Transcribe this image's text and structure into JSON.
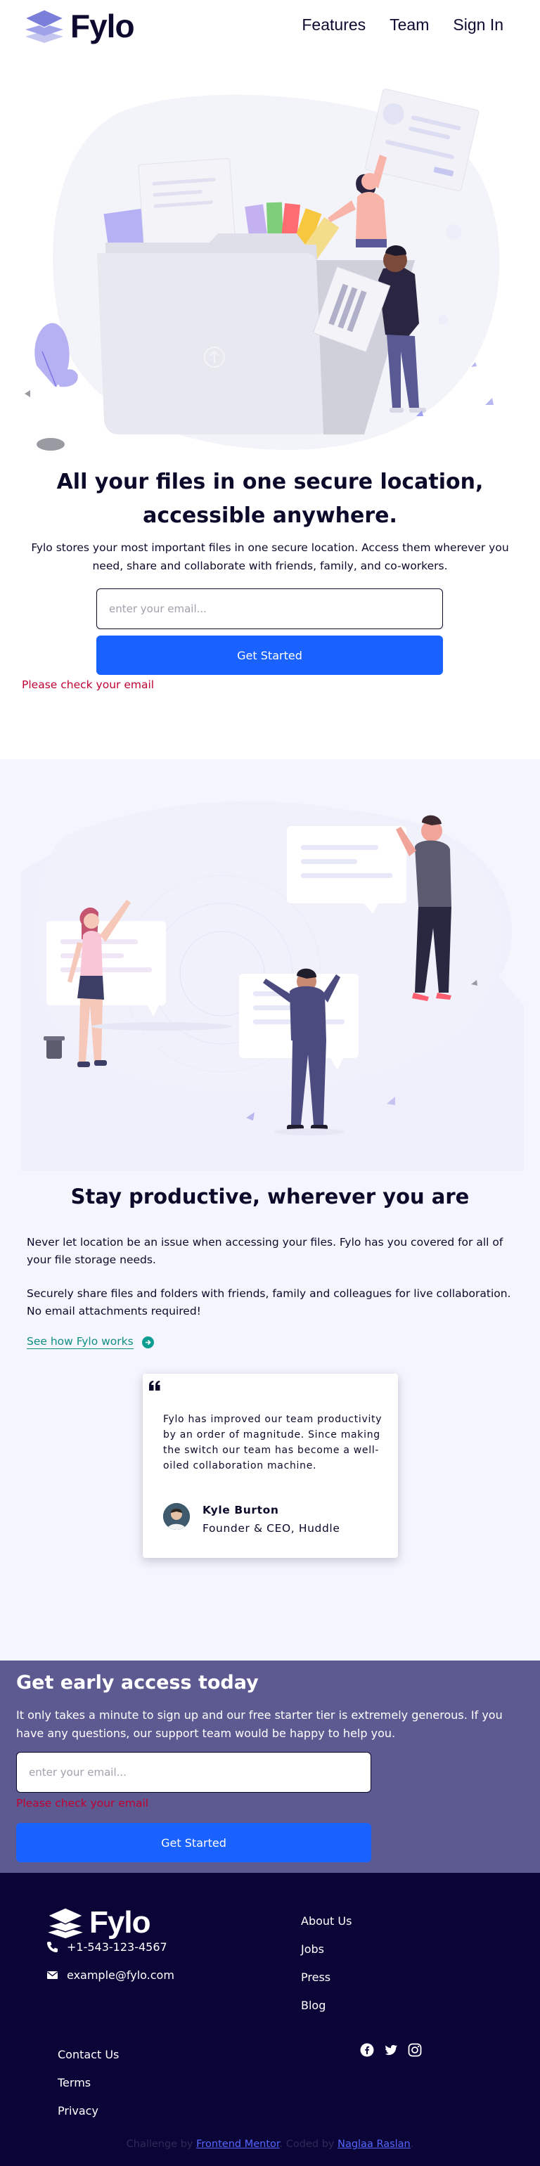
{
  "header": {
    "brand": "Fylo",
    "nav": [
      "Features",
      "Team",
      "Sign In"
    ]
  },
  "hero": {
    "title": "All your files in one secure location, accessible anywhere.",
    "description": "Fylo stores your most important files in one secure location. Access them wherever you need, share and collaborate with friends, family, and co-workers.",
    "email_placeholder": "enter your email...",
    "cta_label": "Get Started",
    "error": "Please check your email"
  },
  "productive": {
    "title": "Stay productive, wherever you are",
    "paragraph_1": "Never let location be an issue when accessing your files. Fylo has you covered for all of your file storage needs.",
    "paragraph_2": "Securely share files and folders with friends, family and colleagues for live collaboration. No email attachments required!",
    "link_label": "See how Fylo works"
  },
  "testimonial": {
    "quote": "Fylo has improved our team productivity by an order of magnitude. Since making the switch our team has become a well-oiled collaboration machine.",
    "name": "Kyle Burton",
    "role": "Founder & CEO, Huddle"
  },
  "early_access": {
    "title": "Get early access today",
    "description": "It only takes a minute to sign up and our free starter tier is extremely generous. If you have any questions, our support team would be happy to help you.",
    "email_placeholder": "enter your email...",
    "error": "Please check your email",
    "cta_label": "Get Started"
  },
  "footer": {
    "brand": "Fylo",
    "phone": "+1-543-123-4567",
    "email": "example@fylo.com",
    "links_col_1": [
      "About Us",
      "Jobs",
      "Press",
      "Blog"
    ],
    "links_col_2": [
      "Contact Us",
      "Terms",
      "Privacy"
    ],
    "socials": [
      "facebook-icon",
      "twitter-icon",
      "instagram-icon"
    ],
    "attribution": {
      "prefix": "Challenge by ",
      "challenge_link": "Frontend Mentor",
      "middle": ". Coded by ",
      "author_link": "Naglaa Raslan",
      "suffix": "."
    }
  },
  "colors": {
    "brand_blue": "#1a62ff",
    "error_red": "#c10033",
    "link_teal": "#0e8f82",
    "early_access_bg": "#5c5a90",
    "footer_bg": "#0b0537",
    "section_bg": "#f5f5fd"
  }
}
